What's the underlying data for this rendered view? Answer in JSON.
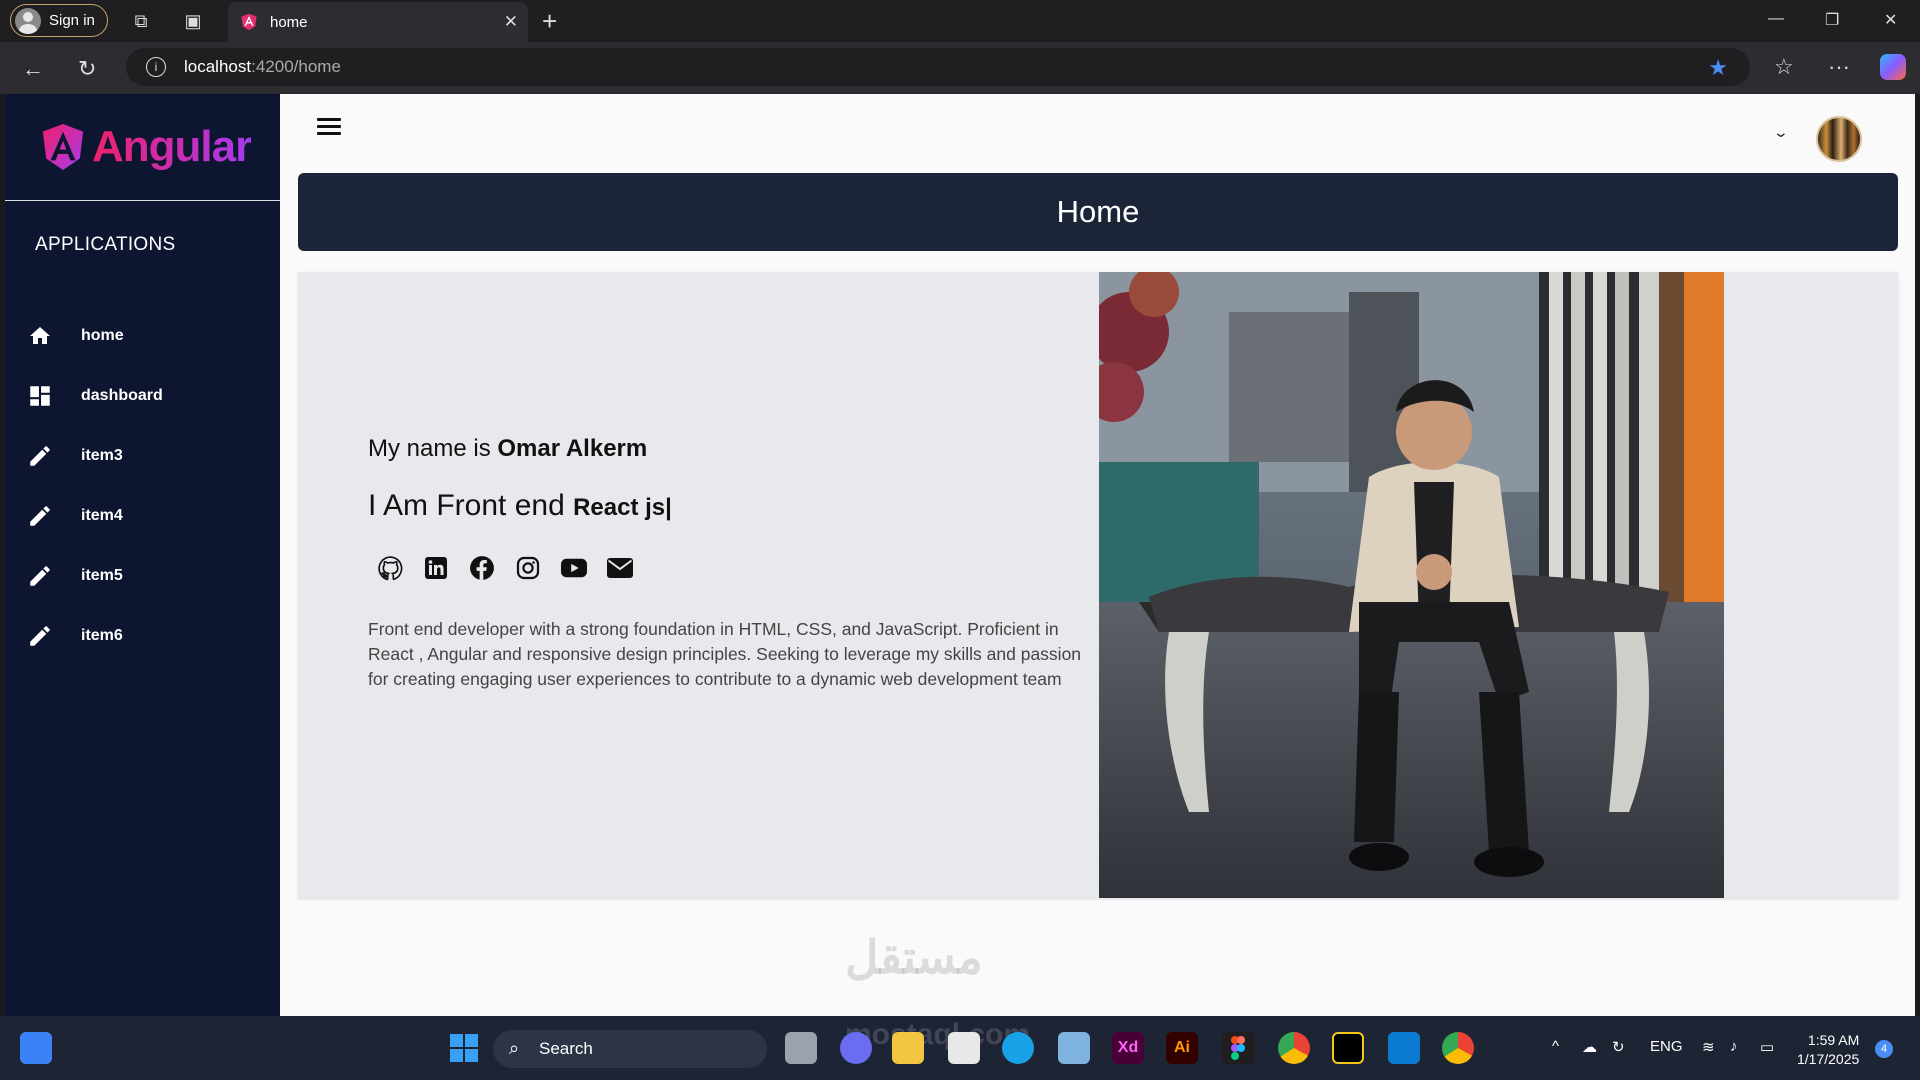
{
  "browser": {
    "sign_in_label": "Sign in",
    "tab_title": "home",
    "url_host": "localhost",
    "url_path": ":4200/home"
  },
  "sidebar": {
    "logo_text": "Angular",
    "section_title": "APPLICATIONS",
    "items": [
      {
        "label": "home",
        "icon": "home-icon"
      },
      {
        "label": "dashboard",
        "icon": "dashboard-icon"
      },
      {
        "label": "item3",
        "icon": "pencil-icon"
      },
      {
        "label": "item4",
        "icon": "pencil-icon"
      },
      {
        "label": "item5",
        "icon": "pencil-icon"
      },
      {
        "label": "item6",
        "icon": "pencil-icon"
      }
    ]
  },
  "header": {
    "page_title": "Home"
  },
  "profile": {
    "name_prefix": "My name is ",
    "name": "Omar Alkerm",
    "role_prefix": "I Am Front end ",
    "role_typed": "React js|",
    "social_icons": [
      "github-icon",
      "linkedin-icon",
      "facebook-icon",
      "instagram-icon",
      "youtube-icon",
      "mail-icon"
    ],
    "bio": "Front end developer with a strong foundation in HTML, CSS, and JavaScript. Proficient in React , Angular and responsive design principles. Seeking to leverage my skills and passion for creating engaging user experiences to contribute to a dynamic web development team"
  },
  "watermark": {
    "arabic": "مستقل",
    "latin": "mostaql.com"
  },
  "taskbar": {
    "search_label": "Search",
    "language": "ENG",
    "time": "1:59 AM",
    "date": "1/17/2025",
    "notification_count": "4"
  },
  "colors": {
    "sidebar_bg": "#0e1530",
    "header_bg": "#1c2538",
    "angular_gradient_start": "#f0206a",
    "angular_gradient_end": "#a63af0"
  }
}
